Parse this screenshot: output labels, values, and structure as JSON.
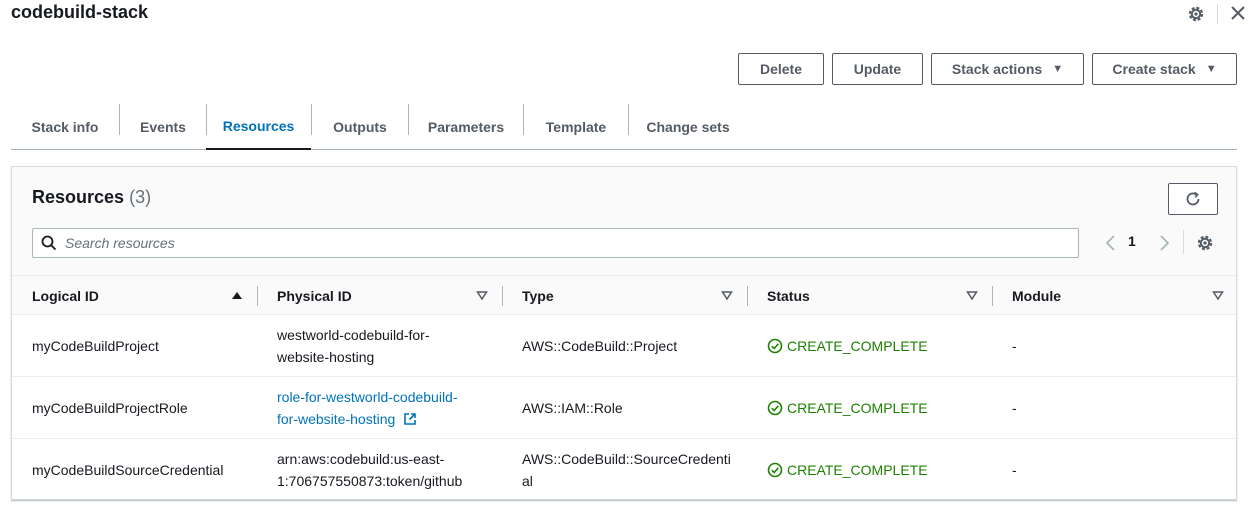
{
  "header": {
    "title": "codebuild-stack"
  },
  "actions": {
    "delete": "Delete",
    "update": "Update",
    "stack_actions": "Stack actions",
    "create_stack": "Create stack"
  },
  "tabs": [
    {
      "label": "Stack info"
    },
    {
      "label": "Events"
    },
    {
      "label": "Resources"
    },
    {
      "label": "Outputs"
    },
    {
      "label": "Parameters"
    },
    {
      "label": "Template"
    },
    {
      "label": "Change sets"
    }
  ],
  "active_tab": "Resources",
  "resources": {
    "title": "Resources",
    "count": "(3)",
    "search_placeholder": "Search resources",
    "page": "1",
    "columns": [
      {
        "label": "Logical ID",
        "sort": "ascending"
      },
      {
        "label": "Physical ID",
        "sort": "none"
      },
      {
        "label": "Type",
        "sort": "none"
      },
      {
        "label": "Status",
        "sort": "none"
      },
      {
        "label": "Module",
        "sort": "none"
      }
    ],
    "rows": [
      {
        "logical_id": "myCodeBuildProject",
        "physical_id_line1": "westworld-codebuild-for-",
        "physical_id_line2": "website-hosting",
        "physical_is_link": false,
        "type_line1": "AWS::CodeBuild::Project",
        "type_line2": "",
        "status": "CREATE_COMPLETE",
        "module": "-"
      },
      {
        "logical_id": "myCodeBuildProjectRole",
        "physical_id_line1": "role-for-westworld-codebuild-",
        "physical_id_line2": "for-website-hosting",
        "physical_is_link": true,
        "type_line1": "AWS::IAM::Role",
        "type_line2": "",
        "status": "CREATE_COMPLETE",
        "module": "-"
      },
      {
        "logical_id": "myCodeBuildSourceCredential",
        "physical_id_line1": "arn:aws:codebuild:us-east-",
        "physical_id_line2": "1:706757550873:token/github",
        "physical_is_link": false,
        "type_line1": "AWS::CodeBuild::SourceCredenti",
        "type_line2": "al",
        "status": "CREATE_COMPLETE",
        "module": "-"
      }
    ]
  },
  "colors": {
    "link": "#0073bb",
    "success": "#1d8102",
    "text": "#16191f",
    "muted": "#545b64"
  },
  "icons": {
    "settings": "gear-icon",
    "close": "close-icon",
    "refresh": "refresh-icon",
    "search": "search-icon",
    "external": "external-link-icon",
    "status_ok": "check-circle-icon"
  }
}
